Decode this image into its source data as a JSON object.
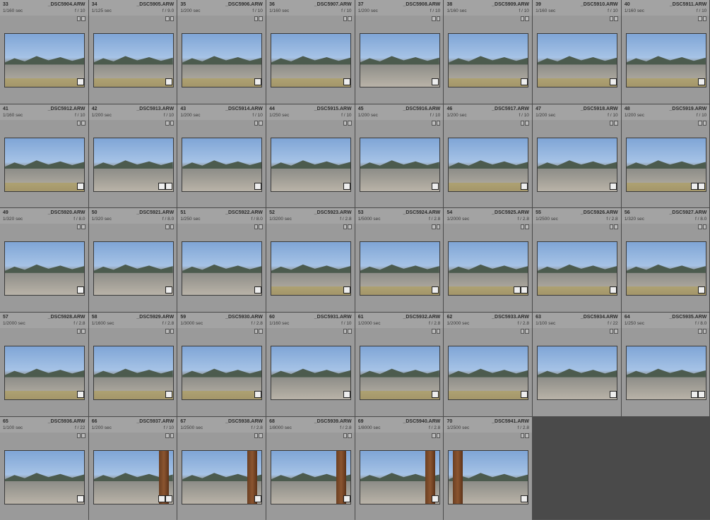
{
  "grid": {
    "items": [
      {
        "idx": "33",
        "filename": "_DSC5904.ARW",
        "shutter": "1/160 sec",
        "aperture": "f / 10",
        "thumb": "road-mountains"
      },
      {
        "idx": "34",
        "filename": "_DSC5905.ARW",
        "shutter": "1/125 sec",
        "aperture": "f / 9.0",
        "thumb": "road-hill"
      },
      {
        "idx": "35",
        "filename": "_DSC5906.ARW",
        "shutter": "1/200 sec",
        "aperture": "f / 10",
        "thumb": "road-sky"
      },
      {
        "idx": "36",
        "filename": "_DSC5907.ARW",
        "shutter": "1/160 sec",
        "aperture": "f / 10",
        "thumb": "road-sky"
      },
      {
        "idx": "37",
        "filename": "_DSC5908.ARW",
        "shutter": "1/200 sec",
        "aperture": "f / 10",
        "thumb": "plain-mountains"
      },
      {
        "idx": "38",
        "filename": "_DSC5909.ARW",
        "shutter": "1/160 sec",
        "aperture": "f / 10",
        "thumb": "road-grass"
      },
      {
        "idx": "39",
        "filename": "_DSC5910.ARW",
        "shutter": "1/160 sec",
        "aperture": "f / 10",
        "thumb": "road-grass"
      },
      {
        "idx": "40",
        "filename": "_DSC5911.ARW",
        "shutter": "1/160 sec",
        "aperture": "f / 10",
        "thumb": "road-mountains"
      },
      {
        "idx": "41",
        "filename": "_DSC5912.ARW",
        "shutter": "1/160 sec",
        "aperture": "f / 10",
        "thumb": "road-hill"
      },
      {
        "idx": "42",
        "filename": "_DSC5913.ARW",
        "shutter": "1/200 sec",
        "aperture": "f / 10",
        "thumb": "plain-mountains"
      },
      {
        "idx": "43",
        "filename": "_DSC5914.ARW",
        "shutter": "1/200 sec",
        "aperture": "f / 10",
        "thumb": "plain-mountains"
      },
      {
        "idx": "44",
        "filename": "_DSC5915.ARW",
        "shutter": "1/250 sec",
        "aperture": "f / 10",
        "thumb": "plain-mountains"
      },
      {
        "idx": "45",
        "filename": "_DSC5916.ARW",
        "shutter": "1/200 sec",
        "aperture": "f / 10",
        "thumb": "plain-mountains"
      },
      {
        "idx": "46",
        "filename": "_DSC5917.ARW",
        "shutter": "1/200 sec",
        "aperture": "f / 10",
        "thumb": "plain-grass"
      },
      {
        "idx": "47",
        "filename": "_DSC5918.ARW",
        "shutter": "1/200 sec",
        "aperture": "f / 10",
        "thumb": "plain-mountains"
      },
      {
        "idx": "48",
        "filename": "_DSC5919.ARW",
        "shutter": "1/200 sec",
        "aperture": "f / 10",
        "thumb": "plain-grass"
      },
      {
        "idx": "49",
        "filename": "_DSC5920.ARW",
        "shutter": "1/320 sec",
        "aperture": "f / 8.0",
        "thumb": "plain-mountains"
      },
      {
        "idx": "50",
        "filename": "_DSC5921.ARW",
        "shutter": "1/320 sec",
        "aperture": "f / 8.0",
        "thumb": "plain-mountains"
      },
      {
        "idx": "51",
        "filename": "_DSC5922.ARW",
        "shutter": "1/250 sec",
        "aperture": "f / 8.0",
        "thumb": "plain-mountains"
      },
      {
        "idx": "52",
        "filename": "_DSC5923.ARW",
        "shutter": "1/3200 sec",
        "aperture": "f / 2.8",
        "thumb": "plain-grass"
      },
      {
        "idx": "53",
        "filename": "_DSC5924.ARW",
        "shutter": "1/5000 sec",
        "aperture": "f / 2.8",
        "thumb": "plain-grass"
      },
      {
        "idx": "54",
        "filename": "_DSC5925.ARW",
        "shutter": "1/2000 sec",
        "aperture": "f / 2.8",
        "thumb": "plain-grass"
      },
      {
        "idx": "55",
        "filename": "_DSC5926.ARW",
        "shutter": "1/2500 sec",
        "aperture": "f / 2.8",
        "thumb": "plain-bush"
      },
      {
        "idx": "56",
        "filename": "_DSC5927.ARW",
        "shutter": "1/320 sec",
        "aperture": "f / 8.0",
        "thumb": "plain-bush"
      },
      {
        "idx": "57",
        "filename": "_DSC5928.ARW",
        "shutter": "1/2000 sec",
        "aperture": "f / 2.8",
        "thumb": "plain-bush"
      },
      {
        "idx": "58",
        "filename": "_DSC5929.ARW",
        "shutter": "1/1600 sec",
        "aperture": "f / 2.8",
        "thumb": "plain-bush"
      },
      {
        "idx": "59",
        "filename": "_DSC5930.ARW",
        "shutter": "1/3000 sec",
        "aperture": "f / 2.8",
        "thumb": "plain-bush"
      },
      {
        "idx": "60",
        "filename": "_DSC5931.ARW",
        "shutter": "1/160 sec",
        "aperture": "f / 10",
        "thumb": "plain-mountains"
      },
      {
        "idx": "61",
        "filename": "_DSC5932.ARW",
        "shutter": "1/2000 sec",
        "aperture": "f / 2.8",
        "thumb": "plain-bush"
      },
      {
        "idx": "62",
        "filename": "_DSC5933.ARW",
        "shutter": "1/2000 sec",
        "aperture": "f / 2.8",
        "thumb": "plain-bush"
      },
      {
        "idx": "63",
        "filename": "_DSC5934.ARW",
        "shutter": "1/100 sec",
        "aperture": "f / 22",
        "thumb": "plain-mountains"
      },
      {
        "idx": "64",
        "filename": "_DSC5935.ARW",
        "shutter": "1/250 sec",
        "aperture": "f / 8.0",
        "thumb": "plain-mountains"
      },
      {
        "idx": "65",
        "filename": "_DSC5936.ARW",
        "shutter": "1/100 sec",
        "aperture": "f / 22",
        "thumb": "plain-mountains"
      },
      {
        "idx": "66",
        "filename": "_DSC5937.ARW",
        "shutter": "1/200 sec",
        "aperture": "f / 10",
        "thumb": "post"
      },
      {
        "idx": "67",
        "filename": "_DSC5938.ARW",
        "shutter": "1/2500 sec",
        "aperture": "f / 2.8",
        "thumb": "post"
      },
      {
        "idx": "68",
        "filename": "_DSC5939.ARW",
        "shutter": "1/8000 sec",
        "aperture": "f / 2.8",
        "thumb": "post"
      },
      {
        "idx": "69",
        "filename": "_DSC5940.ARW",
        "shutter": "1/8000 sec",
        "aperture": "f / 2.8",
        "thumb": "post"
      },
      {
        "idx": "70",
        "filename": "_DSC5941.ARW",
        "shutter": "1/2500 sec",
        "aperture": "f / 2.8",
        "thumb": "post-left"
      }
    ]
  }
}
